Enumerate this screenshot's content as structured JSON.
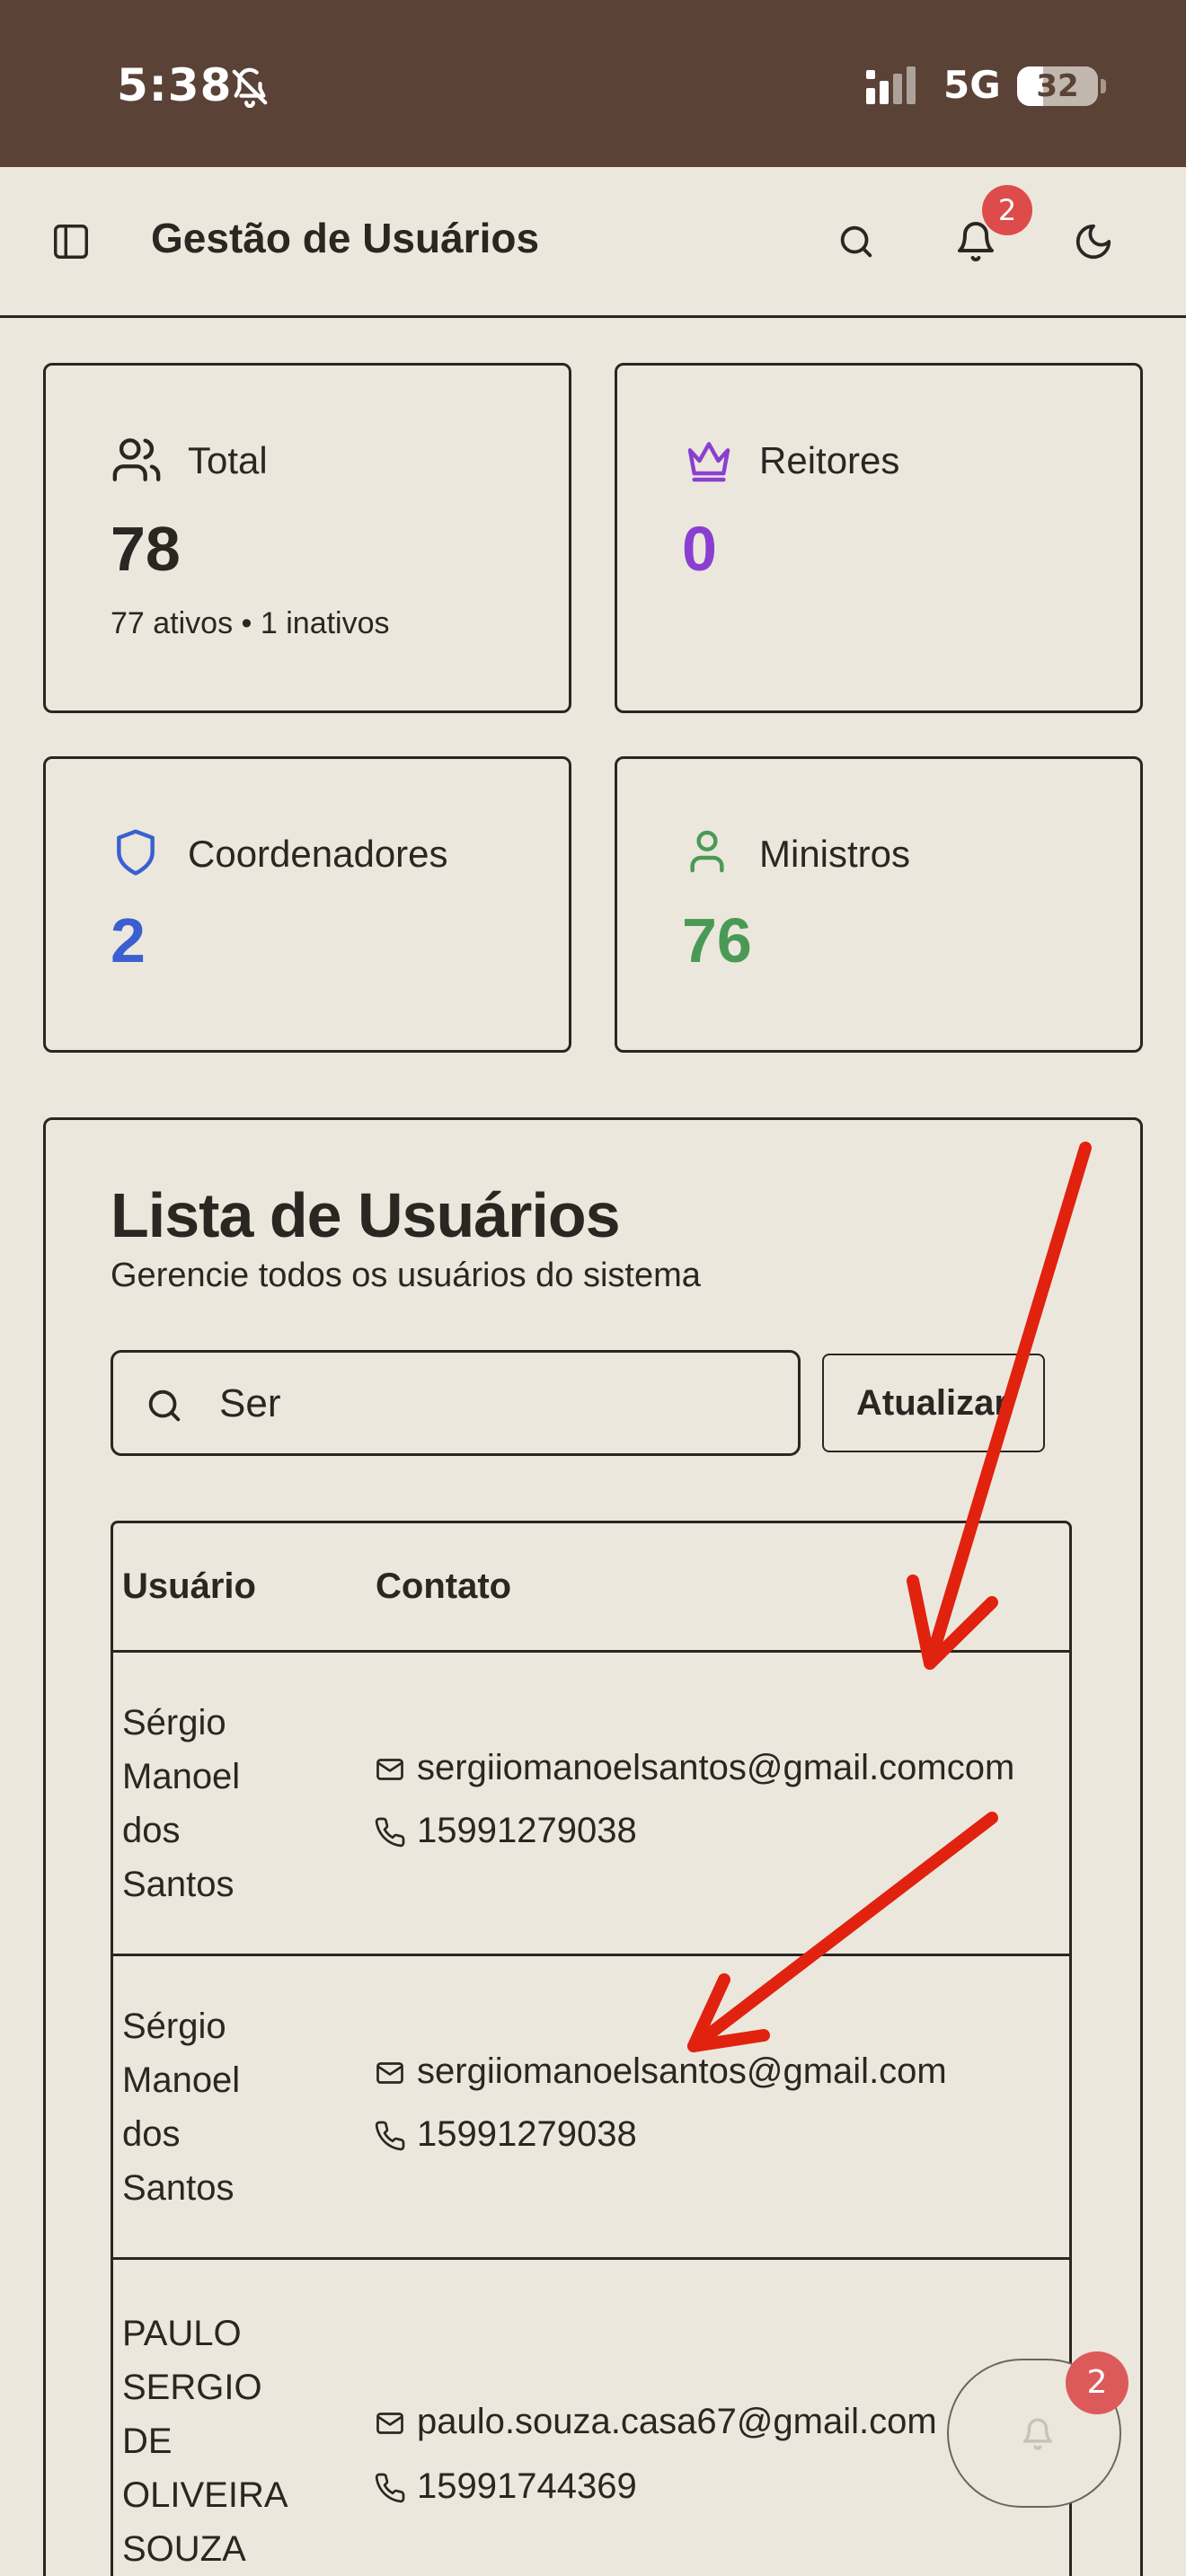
{
  "status_bar": {
    "time": "5:38",
    "network": "5G",
    "battery": "32"
  },
  "header": {
    "title": "Gestão de Usuários",
    "notification_count": "2"
  },
  "stats": {
    "total": {
      "label": "Total",
      "value": "78",
      "sub": "77 ativos • 1 inativos"
    },
    "reitores": {
      "label": "Reitores",
      "value": "0",
      "color": "#8a3fd1"
    },
    "coordenadores": {
      "label": "Coordenadores",
      "value": "2",
      "color": "#3a5fd0"
    },
    "ministros": {
      "label": "Ministros",
      "value": "76",
      "color": "#4a9a55"
    }
  },
  "user_list": {
    "title": "Lista de Usuários",
    "description": "Gerencie todos os usuários do sistema",
    "search_value": "Ser",
    "refresh_label": "Atualizar",
    "columns": [
      "Usuário",
      "Contato"
    ],
    "rows": [
      {
        "name_lines": [
          "Sérgio",
          "Manoel",
          "dos",
          "Santos"
        ],
        "email": "sergiiomanoelsantos@gmail.comcom",
        "phone": "15991279038"
      },
      {
        "name_lines": [
          "Sérgio",
          "Manoel",
          "dos",
          "Santos"
        ],
        "email": "sergiiomanoelsantos@gmail.com",
        "phone": "15991279038"
      },
      {
        "name_lines": [
          "PAULO",
          "SERGIO",
          "DE",
          "OLIVEIRA",
          "SOUZA"
        ],
        "email": "paulo.souza.casa67@gmail.com",
        "phone": "15991744369"
      }
    ]
  },
  "floating_notifications": {
    "count": "2"
  },
  "colors": {
    "background": "#ece7dd",
    "status_bar": "#5a4236",
    "badge": "#dd4b4b",
    "annotation_arrow": "#e0220f"
  }
}
